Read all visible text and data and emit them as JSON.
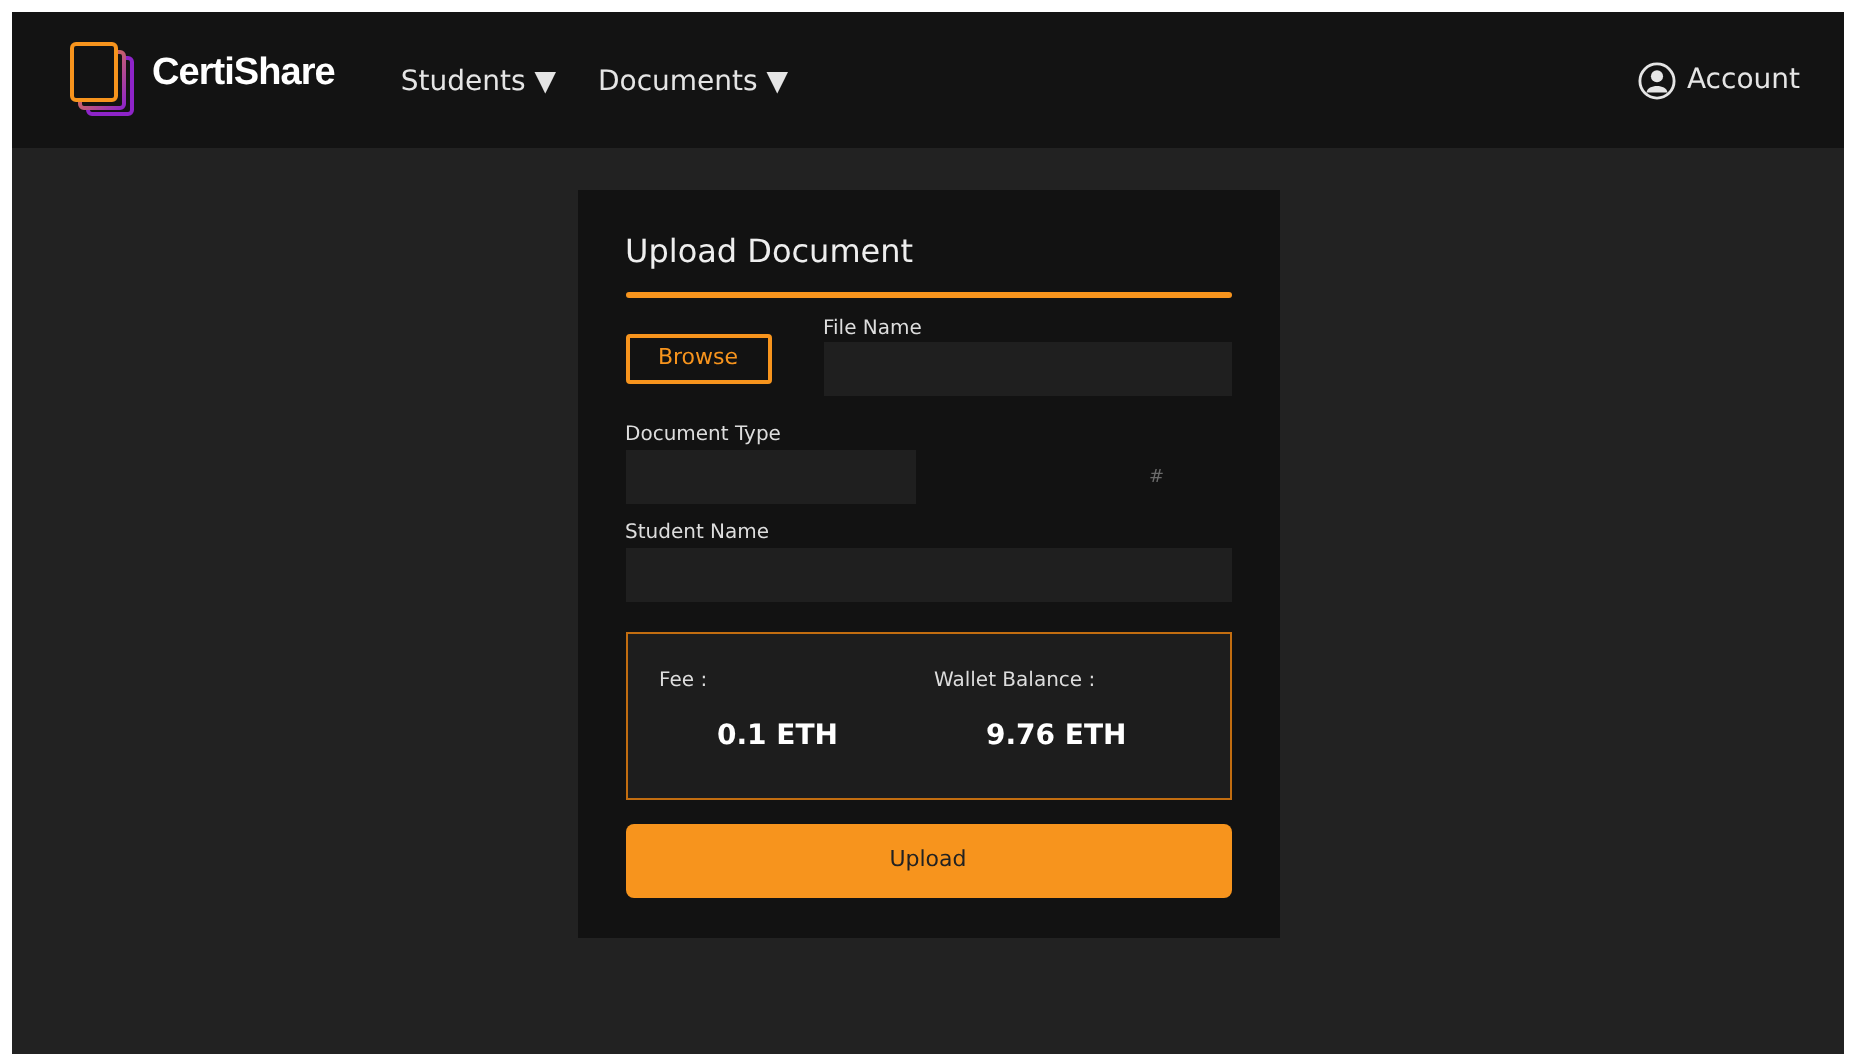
{
  "navbar": {
    "brand": "CertiShare",
    "menus": [
      {
        "label": "Students",
        "caret": "▼"
      },
      {
        "label": "Documents",
        "caret": "▼"
      }
    ],
    "account": "Account"
  },
  "form": {
    "title": "Upload Document",
    "browse_button": "Browse",
    "file_name": {
      "label": "File Name"
    },
    "document_type": {
      "label": "Document Type",
      "mark": "#"
    },
    "student_name": {
      "label": "Student Name"
    },
    "summary": {
      "fee_label": "Fee :",
      "fee": "0.1 ETH",
      "balance_label": "Wallet Balance :",
      "balance": "9.76 ETH"
    },
    "upload_button": "Upload"
  }
}
